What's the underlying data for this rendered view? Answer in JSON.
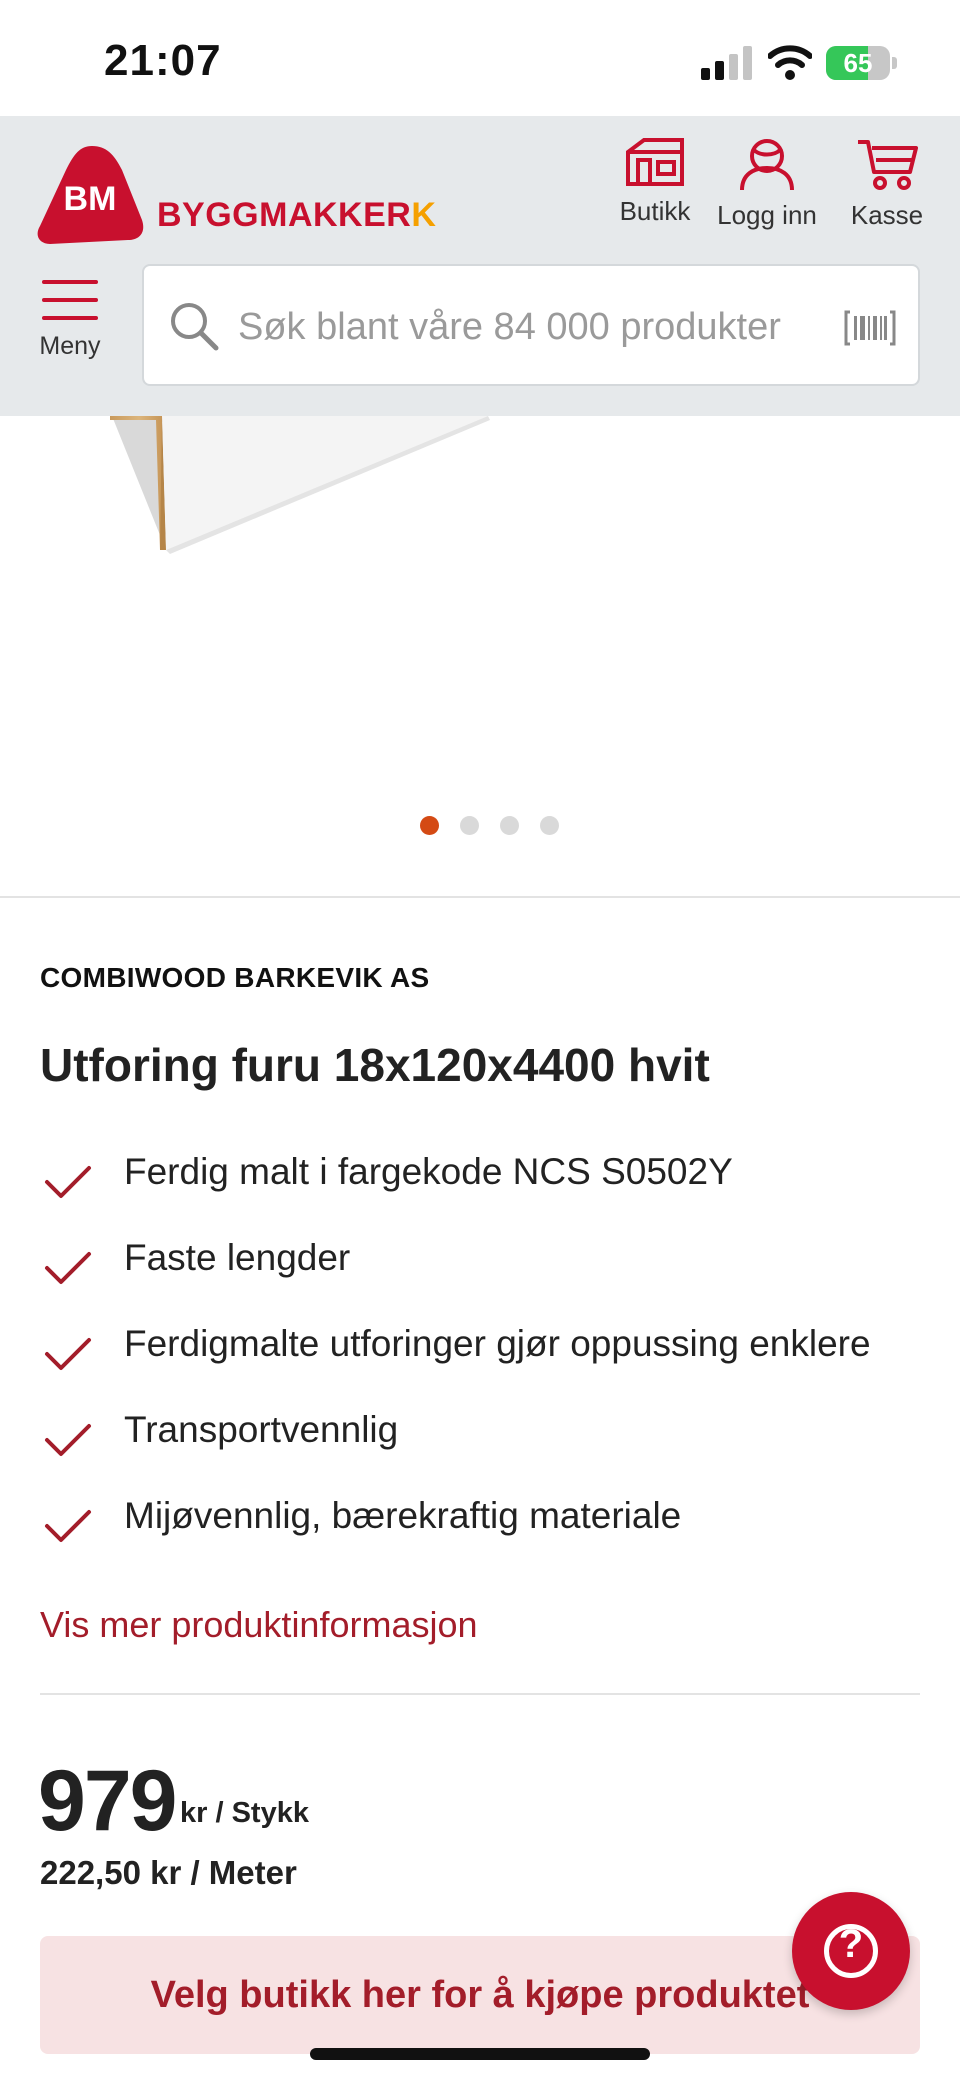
{
  "status_bar": {
    "time": "21:07",
    "battery_percent": "65",
    "battery_level": 0.65,
    "icons": [
      "cellular-signal-icon",
      "wifi-icon",
      "battery-charging-icon"
    ]
  },
  "header": {
    "logo_badge": "BM",
    "logo_text": "BYGGMAKKER",
    "logo_suffix": "K",
    "nav": {
      "store_label": "Butikk",
      "login_label": "Logg inn",
      "cart_label": "Kasse"
    },
    "menu_label": "Meny",
    "search_placeholder": "Søk blant våre 84 000 produkter"
  },
  "colors": {
    "brand_red": "#c8102e",
    "link_red": "#a31d2a",
    "header_bg": "#e6e9eb",
    "accent_orange": "#d44a14",
    "cta_bg": "#f7e2e3"
  },
  "gallery": {
    "image_count": 4,
    "active_index": 0
  },
  "product": {
    "brand": "COMBIWOOD BARKEVIK AS",
    "title": "Utforing furu 18x120x4400 hvit",
    "features": [
      "Ferdig malt i fargekode NCS S0502Y",
      "Faste lengder",
      "Ferdigmalte utforinger gjør oppussing enklere",
      "Transportvennlig",
      "Mijøvennlig, bærekraftig materiale"
    ],
    "more_info_link": "Vis mer produktinformasjon"
  },
  "price": {
    "amount": "979",
    "unit": "kr / Stykk",
    "per_meter": "222,50 kr / Meter"
  },
  "cta": {
    "label": "Velg butikk her for å kjøpe produktet"
  },
  "help": {
    "icon": "question-icon",
    "glyph": "?"
  }
}
